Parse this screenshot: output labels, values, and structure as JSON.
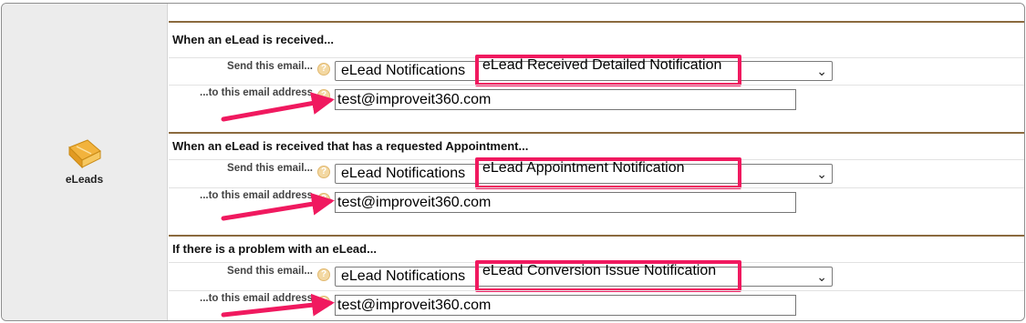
{
  "sidebar": {
    "icon": "eleads-icon",
    "label": "eLeads"
  },
  "sections": [
    {
      "title": "When an eLead is received...",
      "send_label": "Send this email...",
      "address_label": "...to this email address",
      "group": "eLead Notifications",
      "template": "eLead Received Detailed Notification",
      "email": "test@improveit360.com"
    },
    {
      "title": "When an eLead is received that has a requested Appointment...",
      "send_label": "Send this email...",
      "address_label": "...to this email address",
      "group": "eLead Notifications",
      "template": "eLead Appointment Notification",
      "email": "test@improveit360.com"
    },
    {
      "title": "If there is a problem with an eLead...",
      "send_label": "Send this email...",
      "address_label": "...to this email address",
      "group": "eLead Notifications",
      "template": "eLead Conversion Issue Notification",
      "email": "test@improveit360.com"
    }
  ],
  "colors": {
    "highlight": "#f0195f",
    "section_rule": "#8b6a3e"
  }
}
